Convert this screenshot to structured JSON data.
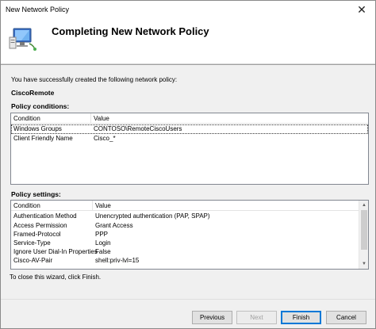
{
  "window": {
    "title": "New Network Policy",
    "close_glyph": "✕"
  },
  "header": {
    "title": "Completing New Network Policy",
    "icon": "computer-network-icon"
  },
  "intro_text": "You have successfully created the following network policy:",
  "policy_name": "CiscoRemote",
  "conditions": {
    "label": "Policy conditions:",
    "columns": [
      "Condition",
      "Value"
    ],
    "rows": [
      {
        "name": "Windows Groups",
        "value": "CONTOSO\\RemoteCiscoUsers"
      },
      {
        "name": "Client Friendly Name",
        "value": "Cisco_*"
      }
    ]
  },
  "settings": {
    "label": "Policy settings:",
    "columns": [
      "Condition",
      "Value"
    ],
    "rows": [
      {
        "name": "Authentication Method",
        "value": "Unencrypted authentication (PAP, SPAP)"
      },
      {
        "name": "Access Permission",
        "value": "Grant Access"
      },
      {
        "name": "Framed-Protocol",
        "value": "PPP"
      },
      {
        "name": "Service-Type",
        "value": "Login"
      },
      {
        "name": "Ignore User Dial-In Properties",
        "value": "False"
      },
      {
        "name": "Cisco-AV-Pair",
        "value": "shell:priv-lvl=15"
      }
    ]
  },
  "close_hint": "To close this wizard, click Finish.",
  "buttons": {
    "previous": "Previous",
    "next": "Next",
    "finish": "Finish",
    "cancel": "Cancel"
  },
  "colors": {
    "accent": "#0078d7",
    "header_bg": "#ffffff",
    "dialog_bg": "#f0f0f0"
  }
}
